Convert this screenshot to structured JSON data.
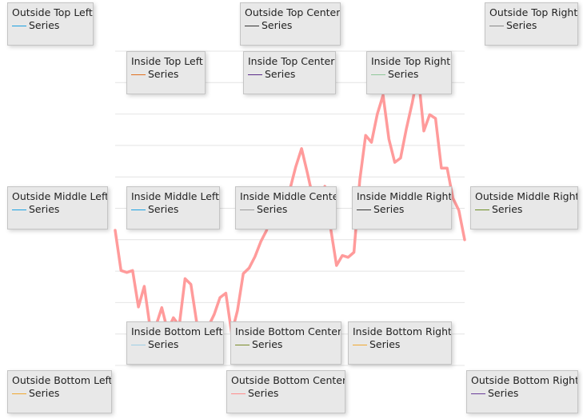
{
  "chart_data": {
    "type": "line",
    "y_axis": {
      "visible": false
    },
    "x_axis": {
      "visible": false
    },
    "grid": "horizontal",
    "series": [
      {
        "color": "#ff9b9b",
        "x": [
          0,
          1,
          2,
          3,
          4,
          5,
          6,
          7,
          8,
          9,
          10,
          11,
          12,
          13,
          14,
          15,
          16,
          17,
          18,
          19,
          20,
          21,
          22,
          23,
          24,
          25,
          26,
          27,
          28,
          29,
          30,
          31,
          32,
          33,
          34,
          35,
          36,
          37,
          38,
          39,
          40,
          41,
          42,
          43,
          44,
          45,
          46,
          47,
          48,
          49,
          50,
          51,
          52,
          53,
          54,
          55,
          56,
          57,
          58,
          59,
          60
        ],
        "values": [
          21.5,
          15.1,
          14.8,
          15.1,
          9.3,
          12.6,
          6.0,
          6.3,
          9.2,
          5.5,
          7.6,
          6.3,
          13.8,
          12.9,
          6.8,
          4.5,
          6.2,
          8.1,
          10.8,
          11.5,
          5.1,
          8.7,
          14.6,
          15.5,
          17.3,
          19.7,
          21.5,
          28.1,
          22.5,
          24.5,
          28.0,
          31.6,
          34.5,
          30.6,
          26.5,
          26.7,
          28.5,
          21.8,
          15.9,
          17.5,
          17.2,
          18.0,
          29.5,
          36.6,
          35.5,
          40.0,
          43.0,
          36.0,
          32.3,
          33.0,
          37.7,
          41.8,
          46.5,
          37.3,
          39.9,
          39.3,
          31.4,
          31.4,
          26.6,
          24.7,
          20.0
        ],
        "xlim": [
          0,
          60
        ],
        "ylim": [
          0,
          50
        ]
      }
    ]
  },
  "legends": [
    {
      "id": "outside-top-left",
      "title": "Outside Top Left",
      "label": "Series",
      "color": "#1ba1e2"
    },
    {
      "id": "outside-top-center",
      "title": "Outside Top Center",
      "label": "Series",
      "color": "#333333"
    },
    {
      "id": "outside-top-right",
      "title": "Outside Top Right",
      "label": "Series",
      "color": "#888888"
    },
    {
      "id": "inside-top-left",
      "title": "Inside Top Left",
      "label": "Series",
      "color": "#e07020"
    },
    {
      "id": "inside-top-center",
      "title": "Inside Top Center",
      "label": "Series",
      "color": "#5b2c8a"
    },
    {
      "id": "inside-top-right",
      "title": "Inside Top Right",
      "label": "Series",
      "color": "#8fc89a"
    },
    {
      "id": "outside-middle-left",
      "title": "Outside Middle Left",
      "label": "Series",
      "color": "#1ba1e2"
    },
    {
      "id": "inside-middle-left",
      "title": "Inside Middle Left",
      "label": "Series",
      "color": "#1ba1e2"
    },
    {
      "id": "inside-middle-center",
      "title": "Inside Middle Cente",
      "label": "Series",
      "color": "#999999"
    },
    {
      "id": "inside-middle-right",
      "title": "Inside Middle Right",
      "label": "Series",
      "color": "#333333"
    },
    {
      "id": "outside-middle-right",
      "title": "Outside Middle Right",
      "label": "Series",
      "color": "#6b8e23"
    },
    {
      "id": "inside-bottom-left",
      "title": "Inside Bottom Left",
      "label": "Series",
      "color": "#9fd0e6"
    },
    {
      "id": "inside-bottom-center",
      "title": "Inside Bottom Center",
      "label": "Series",
      "color": "#7a8a2a"
    },
    {
      "id": "inside-bottom-right",
      "title": "Inside Bottom Right",
      "label": "Series",
      "color": "#f0a830"
    },
    {
      "id": "outside-bottom-left",
      "title": "Outside Bottom Left",
      "label": "Series",
      "color": "#f0a830"
    },
    {
      "id": "outside-bottom-center",
      "title": "Outside Bottom Center",
      "label": "Series",
      "color": "#ff8c8c"
    },
    {
      "id": "outside-bottom-right",
      "title": "Outside Bottom Right",
      "label": "Series",
      "color": "#6a3d9a"
    }
  ]
}
